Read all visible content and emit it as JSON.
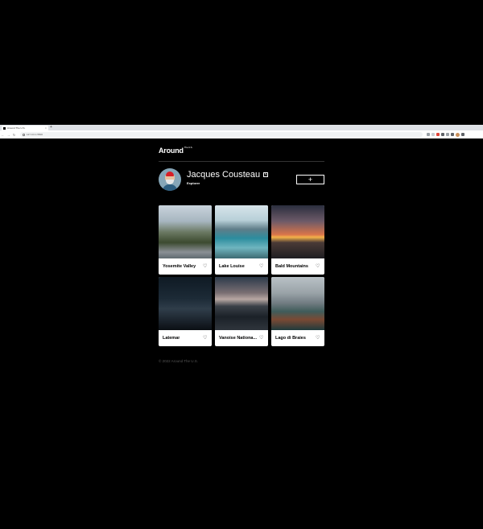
{
  "browser": {
    "tab_title": "Around The U.S.",
    "tab_close": "×",
    "new_tab": "+",
    "url": "127.0.0.1:5500"
  },
  "header": {
    "logo": "Around",
    "logo_sup": "The U.S."
  },
  "profile": {
    "name": "Jacques Cousteau",
    "role": "Explorer",
    "add_label": "+"
  },
  "cards": [
    {
      "title": "Yosemite Valley",
      "image": "yosemite"
    },
    {
      "title": "Lake Louise",
      "image": "louise"
    },
    {
      "title": "Bald Mountains",
      "image": "bald"
    },
    {
      "title": "Latemar",
      "image": "latemar"
    },
    {
      "title": "Vanoise Nationa...",
      "image": "vanoise"
    },
    {
      "title": "Lago di Braies",
      "image": "braies"
    }
  ],
  "footer": {
    "copyright": "© 2022 Around The U.S."
  },
  "icons": {
    "heart": "heart-icon",
    "edit": "pencil-icon"
  }
}
